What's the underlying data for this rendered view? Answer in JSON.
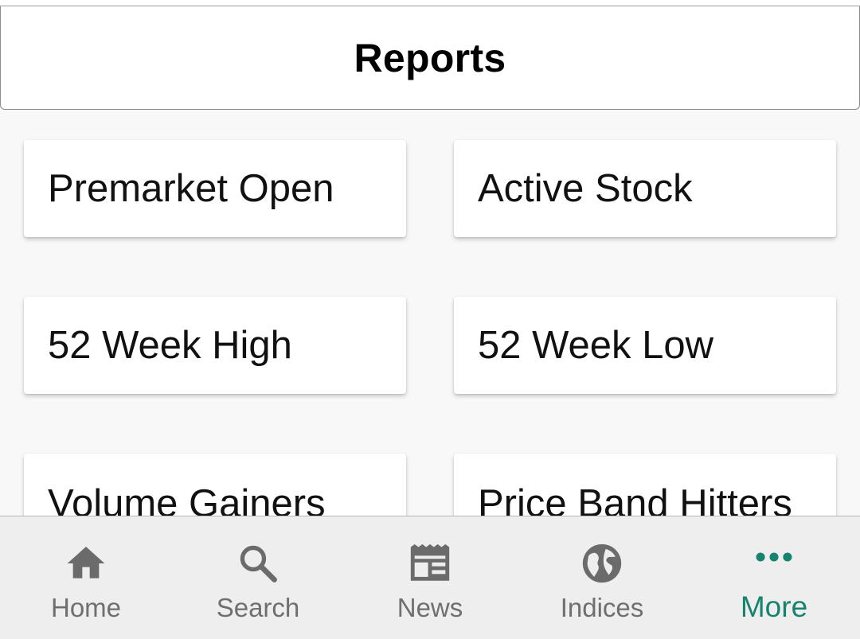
{
  "header": {
    "title": "Reports"
  },
  "reports": [
    {
      "label": "Premarket Open"
    },
    {
      "label": "Active Stock"
    },
    {
      "label": "52 Week High"
    },
    {
      "label": "52 Week Low"
    },
    {
      "label": "Volume Gainers"
    },
    {
      "label": "Price Band Hitters"
    }
  ],
  "bottom_nav": {
    "items": [
      {
        "label": "Home",
        "icon": "home-icon"
      },
      {
        "label": "Search",
        "icon": "search-icon"
      },
      {
        "label": "News",
        "icon": "newspaper-icon"
      },
      {
        "label": "Indices",
        "icon": "globe-icon"
      },
      {
        "label": "More",
        "icon": "more-dots-icon"
      }
    ],
    "active_index": 4
  },
  "colors": {
    "active": "#16836f",
    "inactive_icon": "#6b6b6b",
    "inactive_label": "#6f6f6f",
    "nav_background": "#eeeeee",
    "page_background": "#f8f8f8"
  }
}
